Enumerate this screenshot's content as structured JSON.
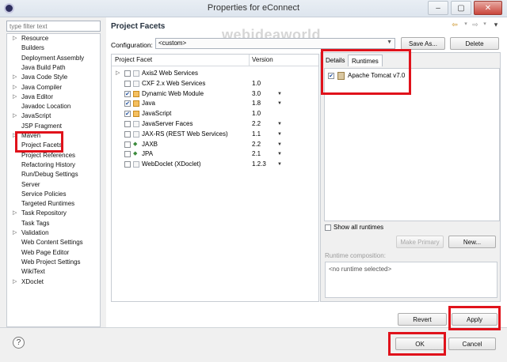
{
  "window": {
    "title": "Properties for eConnect",
    "controls": [
      "–",
      "▢",
      "✕"
    ]
  },
  "filter": {
    "placeholder": "type filter text"
  },
  "nav": {
    "items": [
      {
        "label": "Resource",
        "expandable": true
      },
      {
        "label": "Builders"
      },
      {
        "label": "Deployment Assembly"
      },
      {
        "label": "Java Build Path"
      },
      {
        "label": "Java Code Style",
        "expandable": true
      },
      {
        "label": "Java Compiler",
        "expandable": true
      },
      {
        "label": "Java Editor",
        "expandable": true
      },
      {
        "label": "Javadoc Location"
      },
      {
        "label": "JavaScript",
        "expandable": true
      },
      {
        "label": "JSP Fragment"
      },
      {
        "label": "Maven",
        "expandable": true
      },
      {
        "label": "Project Facets"
      },
      {
        "label": "Project References"
      },
      {
        "label": "Refactoring History"
      },
      {
        "label": "Run/Debug Settings"
      },
      {
        "label": "Server"
      },
      {
        "label": "Service Policies"
      },
      {
        "label": "Targeted Runtimes"
      },
      {
        "label": "Task Repository",
        "expandable": true
      },
      {
        "label": "Task Tags"
      },
      {
        "label": "Validation",
        "expandable": true
      },
      {
        "label": "Web Content Settings"
      },
      {
        "label": "Web Page Editor"
      },
      {
        "label": "Web Project Settings"
      },
      {
        "label": "WikiText"
      },
      {
        "label": "XDoclet",
        "expandable": true
      }
    ]
  },
  "page": {
    "title": "Project Facets",
    "nav_back": "⇦",
    "nav_forward": "⇨",
    "nav_menu": "▾",
    "watermark": "webideaworld"
  },
  "configuration": {
    "label": "Configuration:",
    "value": "<custom>",
    "save_as": "Save As...",
    "delete": "Delete"
  },
  "facets": {
    "columns": [
      "Project Facet",
      "Version"
    ],
    "rows": [
      {
        "name": "Axis2 Web Services",
        "version": "",
        "checked": false,
        "expandable": true
      },
      {
        "name": "CXF 2.x Web Services",
        "version": "1.0",
        "checked": false
      },
      {
        "name": "Dynamic Web Module",
        "version": "3.0",
        "checked": true,
        "dropdown": true
      },
      {
        "name": "Java",
        "version": "1.8",
        "checked": true,
        "dropdown": true
      },
      {
        "name": "JavaScript",
        "version": "1.0",
        "checked": true
      },
      {
        "name": "JavaServer Faces",
        "version": "2.2",
        "checked": false,
        "dropdown": true
      },
      {
        "name": "JAX-RS (REST Web Services)",
        "version": "1.1",
        "checked": false,
        "dropdown": true
      },
      {
        "name": "JAXB",
        "version": "2.2",
        "checked": false,
        "dropdown": true
      },
      {
        "name": "JPA",
        "version": "2.1",
        "checked": false,
        "dropdown": true
      },
      {
        "name": "WebDoclet (XDoclet)",
        "version": "1.2.3",
        "checked": false,
        "dropdown": true
      }
    ]
  },
  "tabs": {
    "details": "Details",
    "runtimes": "Runtimes"
  },
  "runtimes": {
    "items": [
      {
        "label": "Apache Tomcat v7.0",
        "checked": true
      }
    ],
    "show_all": "Show all runtimes",
    "make_primary": "Make Primary",
    "new": "New...",
    "composition_label": "Runtime composition:",
    "composition_value": "<no runtime selected>"
  },
  "actions": {
    "revert": "Revert",
    "apply": "Apply",
    "ok": "OK",
    "cancel": "Cancel",
    "help": "?"
  },
  "colors": {
    "highlight": "#e0121b",
    "accent": "#1a4b9c"
  }
}
